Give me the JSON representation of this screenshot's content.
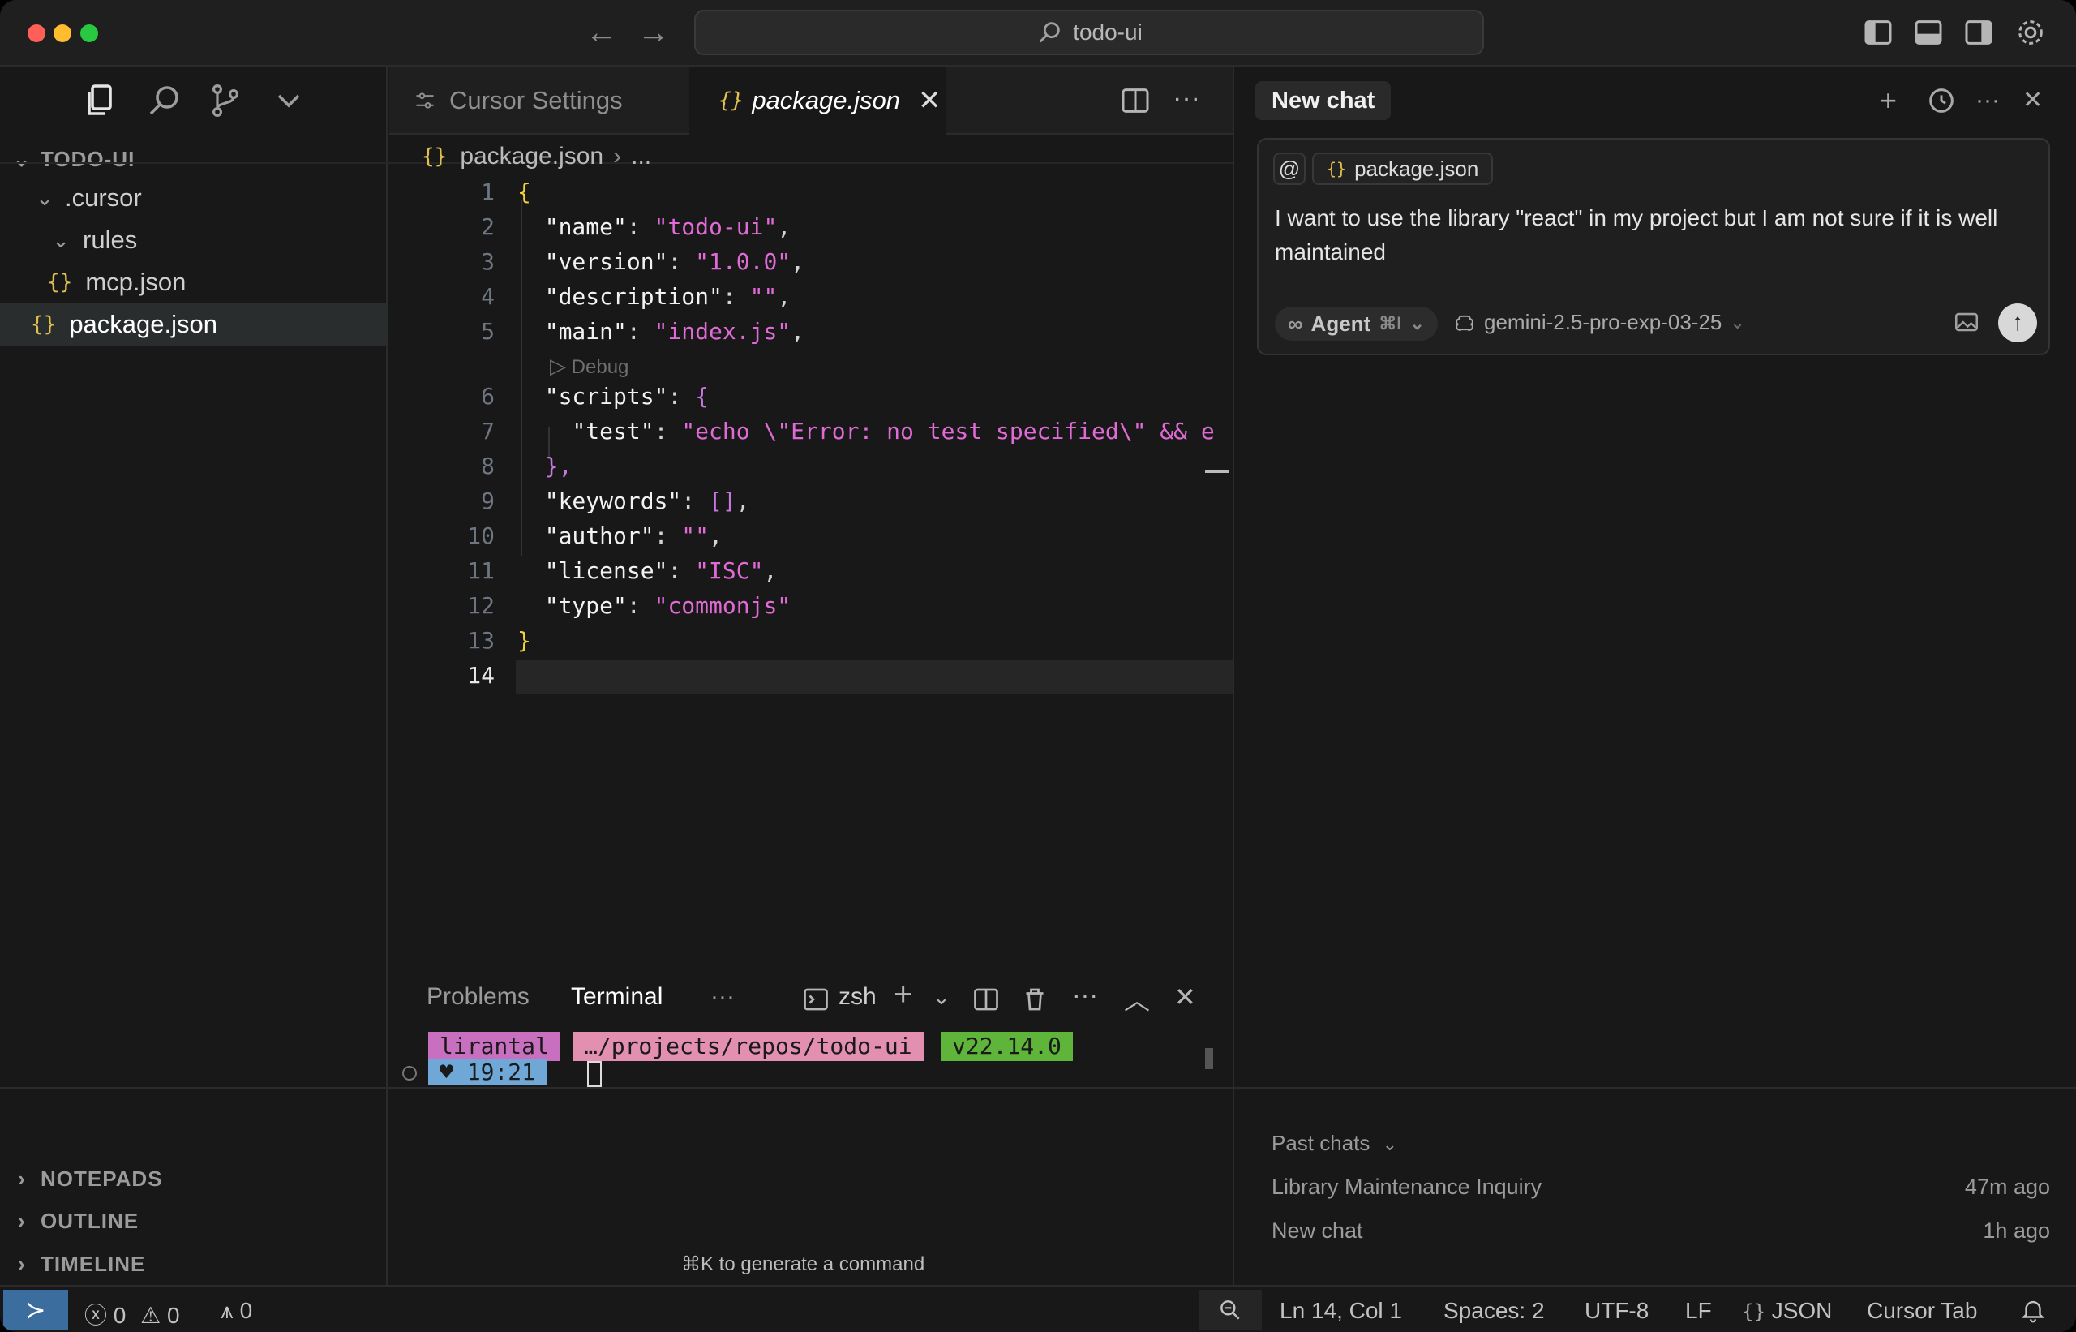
{
  "titlebar": {
    "search_text": "todo-ui"
  },
  "explorer": {
    "header": "TODO-UI",
    "items": [
      {
        "label": ".cursor",
        "type": "folder"
      },
      {
        "label": "rules",
        "type": "folder"
      },
      {
        "label": "mcp.json",
        "type": "json"
      },
      {
        "label": "package.json",
        "type": "json"
      }
    ],
    "sections": [
      "NOTEPADS",
      "OUTLINE",
      "TIMELINE"
    ]
  },
  "editor": {
    "tabs": [
      {
        "label": "Cursor Settings"
      },
      {
        "label": "package.json"
      }
    ],
    "breadcrumb": {
      "file": "package.json",
      "more": "..."
    },
    "codelens": "Debug",
    "line_numbers": [
      "1",
      "2",
      "3",
      "4",
      "5",
      "6",
      "7",
      "8",
      "9",
      "10",
      "11",
      "12",
      "13",
      "14"
    ],
    "lines": {
      "l1": "{",
      "l2_key": "\"name\"",
      "l2_val": "\"todo-ui\"",
      "l3_key": "\"version\"",
      "l3_val": "\"1.0.0\"",
      "l4_key": "\"description\"",
      "l4_val": "\"\"",
      "l5_key": "\"main\"",
      "l5_val": "\"index.js\"",
      "l6_key": "\"scripts\"",
      "l6_open": "{",
      "l7_key": "\"test\"",
      "l7_val": "\"echo \\\"Error: no test specified\\\" && e",
      "l8": "},",
      "l9_key": "\"keywords\"",
      "l9_val": "[]",
      "l10_key": "\"author\"",
      "l10_val": "\"\"",
      "l11_key": "\"license\"",
      "l11_val": "\"ISC\"",
      "l12_key": "\"type\"",
      "l12_val": "\"commonjs\"",
      "l13": "}"
    }
  },
  "panel": {
    "tabs": [
      "Problems",
      "Terminal"
    ],
    "more": "···",
    "shell": "zsh",
    "prompt": {
      "user": "lirantal",
      "path": "…/projects/repos/todo-ui",
      "node": "v22.14.0",
      "time": "♥ 19:21"
    },
    "hint": "⌘K to generate a command"
  },
  "chat": {
    "title": "New chat",
    "context_at": "@",
    "context_file": "package.json",
    "message": "I want to use the library \"react\" in my project but I am not sure if it is well maintained",
    "agent_label": "Agent",
    "agent_shortcut": "⌘I",
    "model": "gemini-2.5-pro-exp-03-25",
    "past_label": "Past chats",
    "past": [
      {
        "title": "Library Maintenance Inquiry",
        "time": "47m ago"
      },
      {
        "title": "New chat",
        "time": "1h ago"
      }
    ]
  },
  "statusbar": {
    "errors": "0",
    "warnings": "0",
    "ports": "0",
    "position": "Ln 14, Col 1",
    "spaces": "Spaces: 2",
    "encoding": "UTF-8",
    "eol": "LF",
    "language": "JSON",
    "cursor_tab": "Cursor Tab"
  },
  "colors": {
    "accent_remote": "#3b6e9f",
    "json_key": "#f2f2f2",
    "json_string": "#e06bd6",
    "prompt_user_bg": "#c96fc0",
    "prompt_path_bg": "#e28fb0",
    "prompt_node_bg": "#5fb53a",
    "prompt_time_bg": "#6fa7d6"
  }
}
